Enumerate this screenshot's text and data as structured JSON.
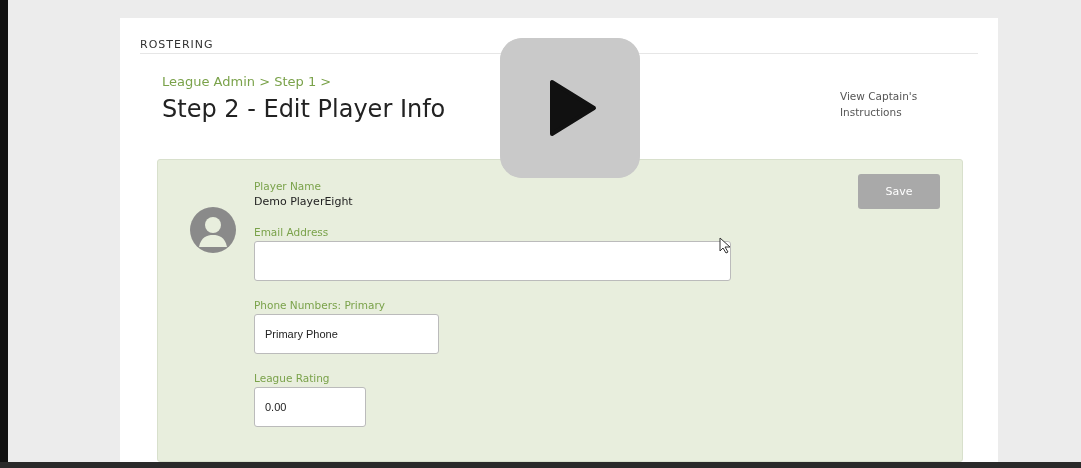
{
  "section_title": "ROSTERING",
  "breadcrumb": "League Admin > Step 1 >",
  "page_title": "Step 2 - Edit Player Info",
  "captain_link": "View Captain's Instructions",
  "player": {
    "label": "Player Name",
    "value": "Demo PlayerEight"
  },
  "fields": [
    {
      "label": "Email Address"
    },
    {
      "label": "Phone Numbers: Primary",
      "value": "Primary Phone"
    },
    {
      "label": "League Rating",
      "value": "0.00"
    }
  ],
  "save_button": {
    "label": "Save",
    "disabled": true
  }
}
